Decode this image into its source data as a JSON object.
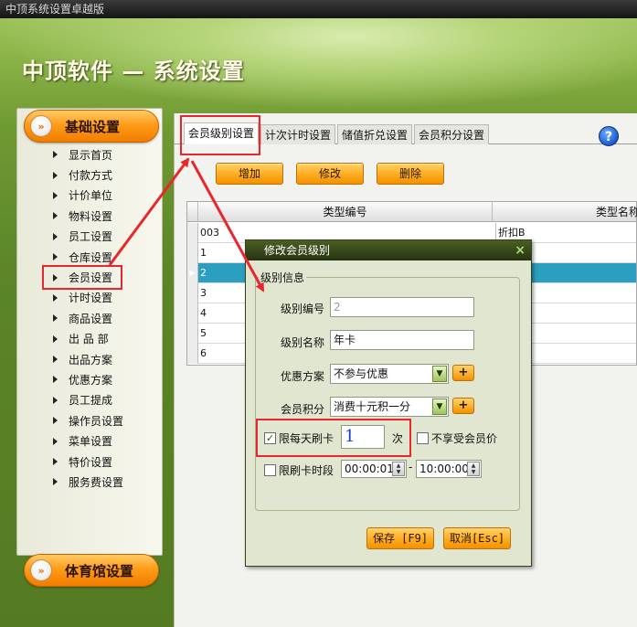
{
  "window": {
    "title": "中顶系统设置卓越版"
  },
  "header": {
    "app_title": "中顶软件 — 系统设置"
  },
  "sidebar": {
    "section_basic": "基础设置",
    "section_gym": "体育馆设置",
    "items": [
      {
        "label": "显示首页"
      },
      {
        "label": "付款方式"
      },
      {
        "label": "计价单位"
      },
      {
        "label": "物料设置"
      },
      {
        "label": "员工设置"
      },
      {
        "label": "仓库设置"
      },
      {
        "label": "会员设置"
      },
      {
        "label": "计时设置"
      },
      {
        "label": "商品设置"
      },
      {
        "label": "出 品 部"
      },
      {
        "label": "出品方案"
      },
      {
        "label": "优惠方案"
      },
      {
        "label": "员工提成"
      },
      {
        "label": "操作员设置"
      },
      {
        "label": "菜单设置"
      },
      {
        "label": "特价设置"
      },
      {
        "label": "服务费设置"
      }
    ],
    "active_item": "会员设置"
  },
  "tabs": [
    {
      "label": "会员级别设置"
    },
    {
      "label": "计次计时设置"
    },
    {
      "label": "储值折兑设置"
    },
    {
      "label": "会员积分设置"
    }
  ],
  "help": {
    "symbol": "?"
  },
  "toolbar": {
    "add": "增加",
    "edit": "修改",
    "delete": "删除"
  },
  "grid": {
    "columns": [
      "类型编号",
      "类型名称"
    ],
    "rows": [
      {
        "code": "003",
        "name": "折扣B"
      },
      {
        "code": "1",
        "name": ""
      },
      {
        "code": "2",
        "name": ""
      },
      {
        "code": "3",
        "name": ""
      },
      {
        "code": "4",
        "name": ""
      },
      {
        "code": "5",
        "name": ""
      },
      {
        "code": "6",
        "name": ""
      }
    ],
    "selected_index": 2
  },
  "dialog": {
    "title": "修改会员级别",
    "close": "×",
    "group_label": "级别信息",
    "level_code_label": "级别编号",
    "level_code_value": "2",
    "level_name_label": "级别名称",
    "level_name_value": "年卡",
    "discount_label": "优惠方案",
    "discount_value": "不参与优惠",
    "points_label": "会员积分",
    "points_value": "消费十元积一分",
    "plus": "+",
    "limit_daily_label": "限每天刷卡",
    "limit_daily_checked": true,
    "limit_daily_count": "1",
    "limit_daily_unit": "次",
    "no_member_price_label": "不享受会员价",
    "no_member_price_checked": false,
    "limit_period_label": "限刷卡时段",
    "limit_period_checked": false,
    "period_start": "00:00:01",
    "period_sep": "-",
    "period_end": "10:00:00",
    "save": "保存 [F9]",
    "cancel": "取消[Esc]"
  },
  "colors": {
    "accent_orange": "#f39100",
    "highlight_red": "#e8272c",
    "selected_row": "#2a9fc0",
    "dialog_title": "#263312"
  }
}
